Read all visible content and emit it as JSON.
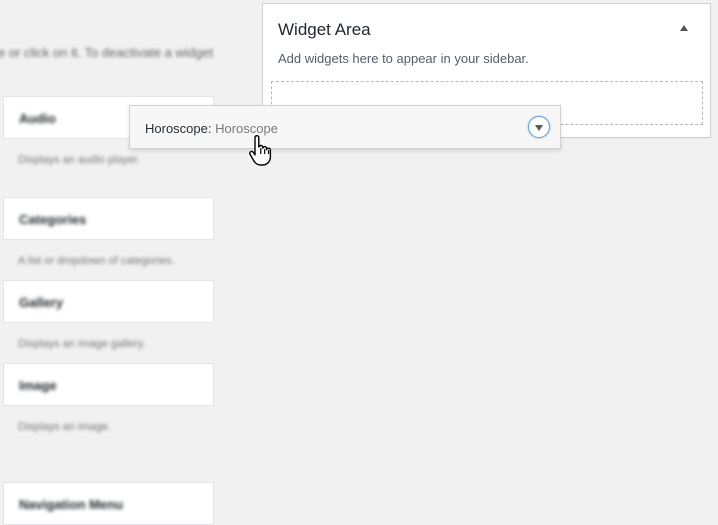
{
  "available_widgets": {
    "instructions": "e or click on it. To deactivate a widget",
    "items": [
      {
        "title": "Audio",
        "description": "Displays an audio player."
      },
      {
        "title": "Categories",
        "description": "A list or dropdown of categories."
      },
      {
        "title": "Gallery",
        "description": "Displays an image gallery."
      },
      {
        "title": "Image",
        "description": "Displays an image."
      },
      {
        "title": "Navigation Menu",
        "description": ""
      }
    ]
  },
  "widget_area": {
    "title": "Widget Area",
    "description": "Add widgets here to appear in your sidebar.",
    "collapse_icon": "triangle-up-icon"
  },
  "dragged_widget": {
    "name": "Horoscope:",
    "subtitle": "Horoscope",
    "toggle_icon": "chevron-down-icon"
  },
  "cursor": {
    "icon": "hand-pointer-icon"
  },
  "colors": {
    "accent": "#5b9dd9",
    "background": "#f1f1f1"
  }
}
